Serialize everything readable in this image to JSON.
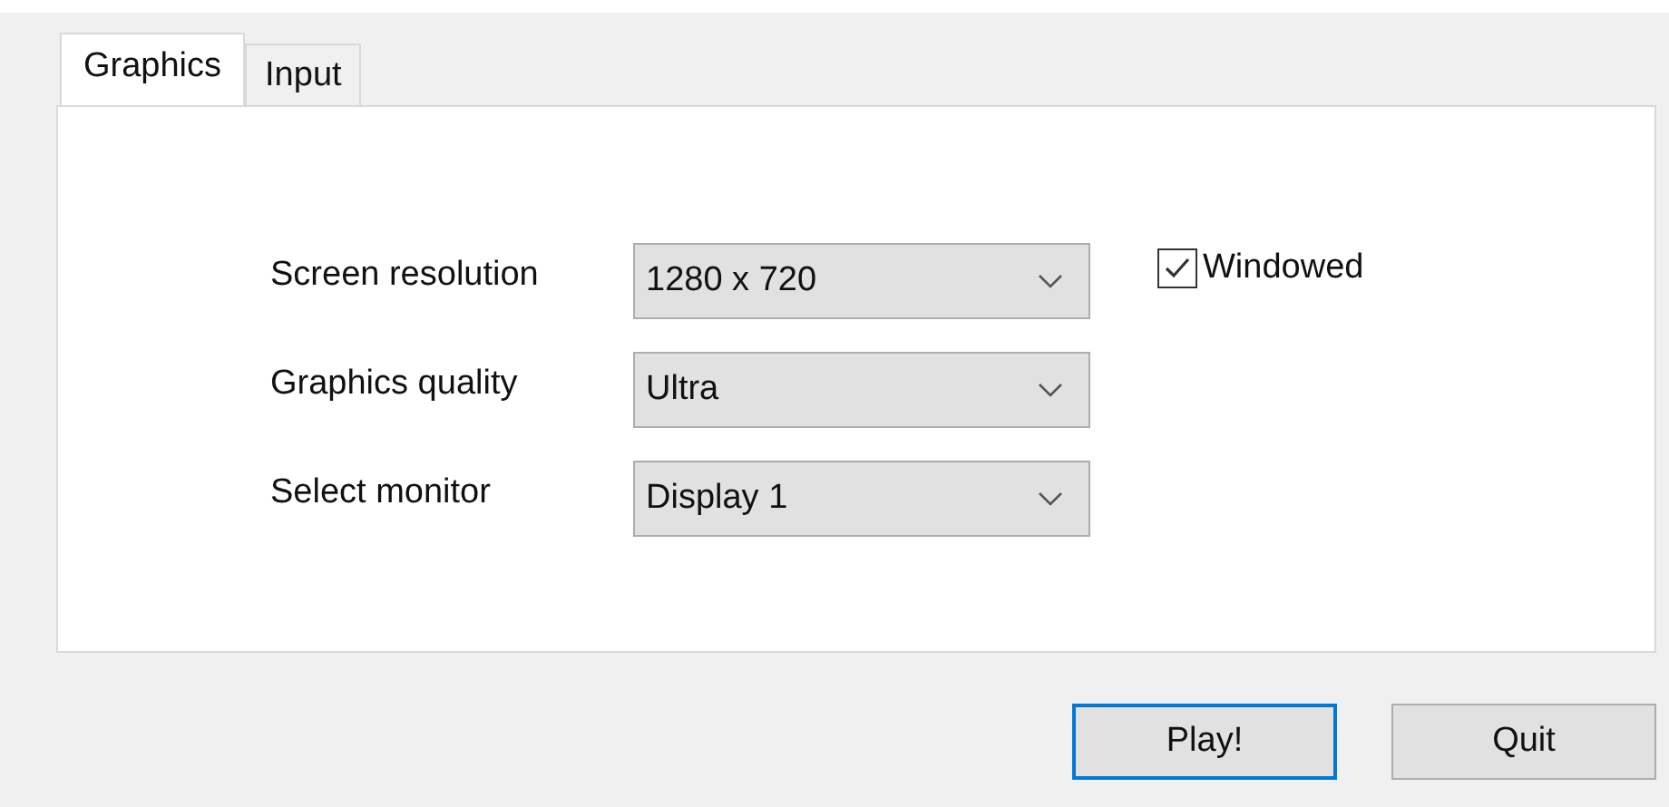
{
  "tabs": [
    {
      "label": "Graphics",
      "selected": true
    },
    {
      "label": "Input",
      "selected": false
    }
  ],
  "settings": [
    {
      "label": "Screen resolution",
      "value": "1280 x 720"
    },
    {
      "label": "Graphics quality",
      "value": "Ultra"
    },
    {
      "label": "Select monitor",
      "value": "Display 1"
    }
  ],
  "windowed": {
    "label": "Windowed",
    "checked": true
  },
  "buttons": [
    {
      "label": "Play!",
      "focused": true
    },
    {
      "label": "Quit",
      "focused": false
    }
  ]
}
